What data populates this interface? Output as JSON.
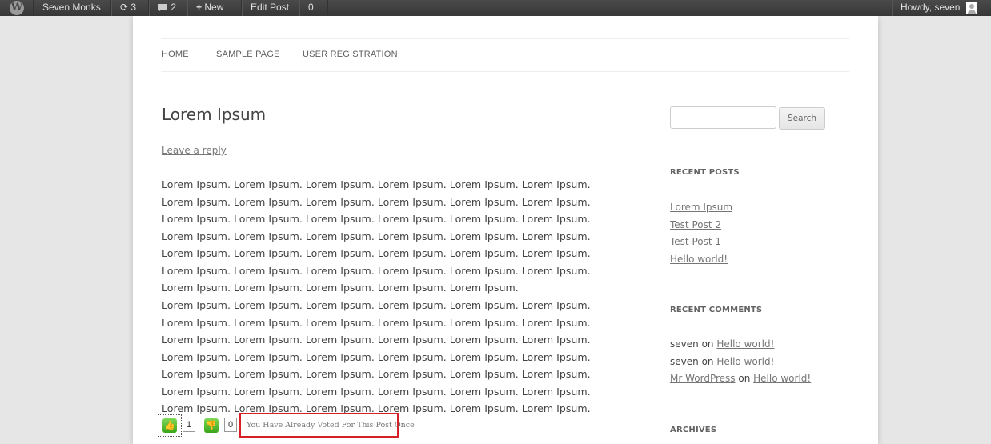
{
  "adminbar": {
    "site_name": "Seven Monks",
    "updates_count": "3",
    "comments_count": "2",
    "new_label": "New",
    "edit_post_label": "Edit Post",
    "zero_label": "0",
    "howdy": "Howdy, seven"
  },
  "nav": {
    "items": [
      {
        "label": "HOME"
      },
      {
        "label": "SAMPLE PAGE"
      },
      {
        "label": "USER REGISTRATION"
      }
    ]
  },
  "post": {
    "title": "Lorem Ipsum",
    "reply_link": "Leave a reply",
    "paragraph1": "Lorem Ipsum. Lorem Ipsum. Lorem Ipsum. Lorem Ipsum. Lorem Ipsum. Lorem Ipsum. Lorem Ipsum. Lorem Ipsum. Lorem Ipsum. Lorem Ipsum. Lorem Ipsum. Lorem Ipsum. Lorem Ipsum. Lorem Ipsum. Lorem Ipsum. Lorem Ipsum. Lorem Ipsum. Lorem Ipsum. Lorem Ipsum. Lorem Ipsum. Lorem Ipsum. Lorem Ipsum. Lorem Ipsum. Lorem Ipsum. Lorem Ipsum. Lorem Ipsum. Lorem Ipsum. Lorem Ipsum. Lorem Ipsum. Lorem Ipsum. Lorem Ipsum. Lorem Ipsum. Lorem Ipsum. Lorem Ipsum. Lorem Ipsum. Lorem Ipsum. Lorem Ipsum. Lorem Ipsum. Lorem Ipsum. Lorem Ipsum. Lorem Ipsum.",
    "paragraph2": "Lorem Ipsum. Lorem Ipsum. Lorem Ipsum. Lorem Ipsum. Lorem Ipsum. Lorem Ipsum. Lorem Ipsum. Lorem Ipsum. Lorem Ipsum. Lorem Ipsum. Lorem Ipsum. Lorem Ipsum. Lorem Ipsum. Lorem Ipsum. Lorem Ipsum. Lorem Ipsum. Lorem Ipsum. Lorem Ipsum. Lorem Ipsum. Lorem Ipsum. Lorem Ipsum. Lorem Ipsum. Lorem Ipsum. Lorem Ipsum. Lorem Ipsum. Lorem Ipsum. Lorem Ipsum. Lorem Ipsum. Lorem Ipsum. Lorem Ipsum. Lorem Ipsum. Lorem Ipsum. Lorem Ipsum. Lorem Ipsum. Lorem Ipsum. Lorem Ipsum. Lorem Ipsum. Lorem Ipsum. Lorem Ipsum. Lorem Ipsum. Lorem Ipsum. Lorem Ipsum."
  },
  "voting": {
    "up_count": "1",
    "down_count": "0",
    "message": "You Have Already Voted For This Post Once",
    "accent_color": "#d61f26",
    "thumb_color": "#4cbb2a"
  },
  "sidebar": {
    "search_button": "Search",
    "recent_posts_title": "RECENT POSTS",
    "recent_posts": [
      "Lorem Ipsum",
      "Test Post 2",
      "Test Post 1",
      "Hello world!"
    ],
    "recent_comments_title": "RECENT COMMENTS",
    "recent_comments": [
      {
        "author": "seven",
        "on": "on",
        "post": "Hello world!"
      },
      {
        "author": "seven",
        "on": "on",
        "post": "Hello world!"
      },
      {
        "author": "Mr WordPress",
        "on": "on",
        "post": "Hello world!"
      }
    ],
    "archives_title": "ARCHIVES"
  }
}
